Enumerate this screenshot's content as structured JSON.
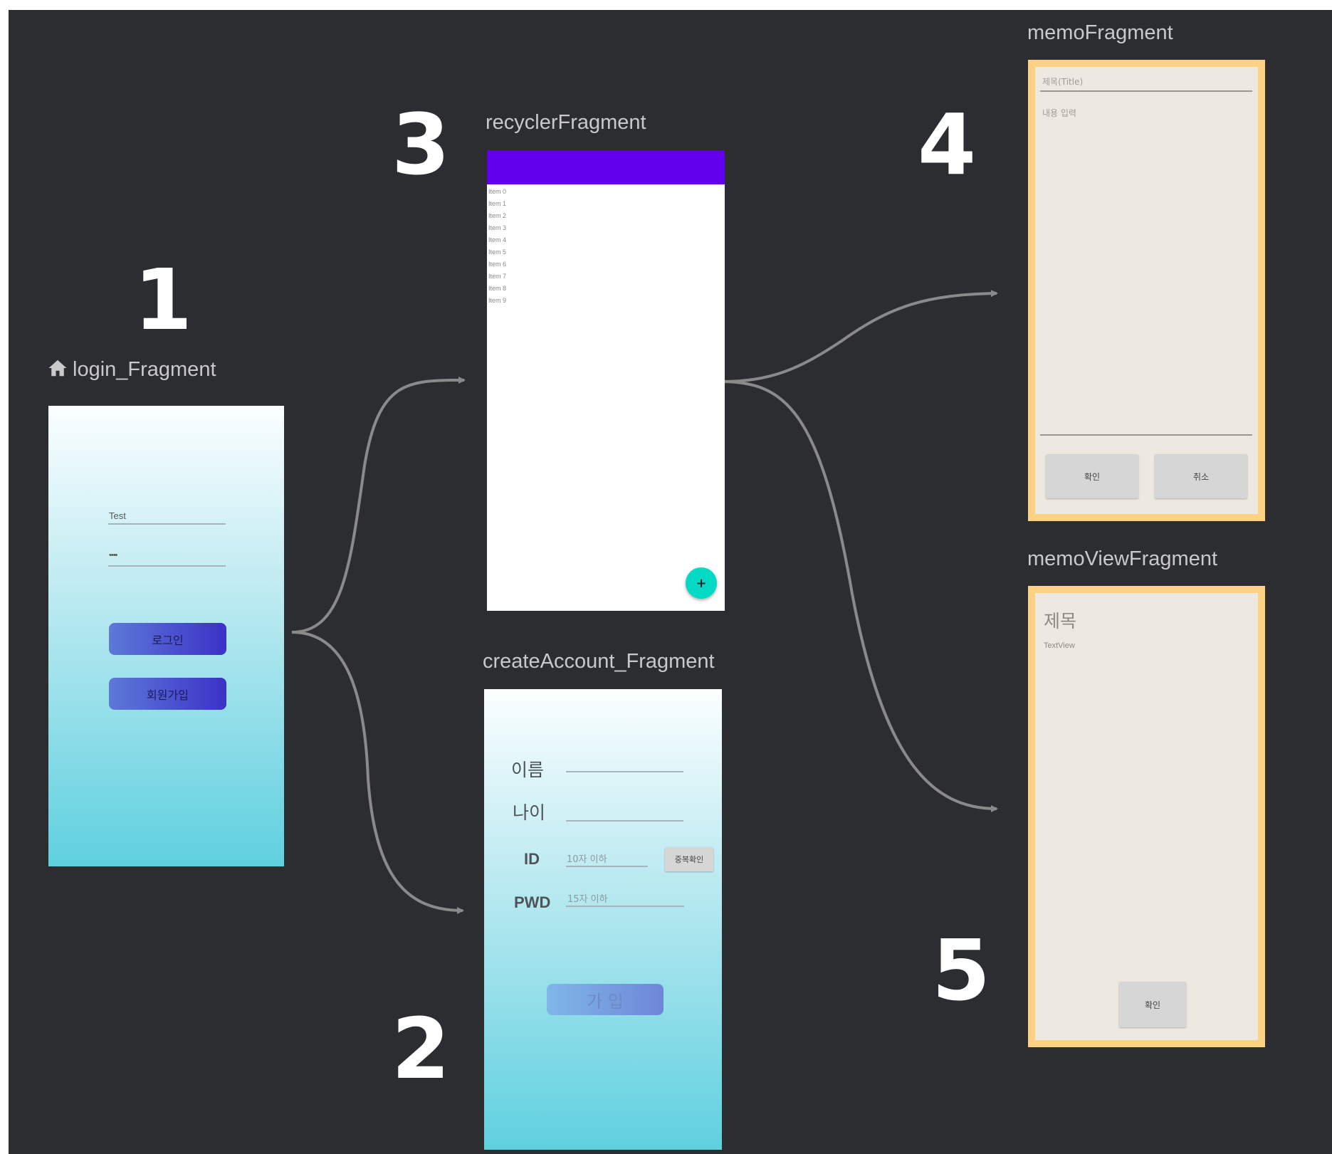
{
  "fragments": {
    "login": {
      "title": "login_Fragment",
      "username_value": "Test",
      "password_value": "••••",
      "login_button": "로그인",
      "signup_button": "회원가입"
    },
    "create_account": {
      "title": "createAccount_Fragment",
      "name_label": "이름",
      "age_label": "나이",
      "id_label": "ID",
      "id_hint": "10자 이하",
      "duplicate_check_button": "중복확인",
      "pwd_label": "PWD",
      "pwd_hint": "15자 이하",
      "join_button": "가 입"
    },
    "recycler": {
      "title": "recyclerFragment",
      "items": [
        "Item 0",
        "Item 1",
        "Item 2",
        "Item 3",
        "Item 4",
        "Item 5",
        "Item 6",
        "Item 7",
        "Item 8",
        "Item 9"
      ],
      "fab_label": "+"
    },
    "memo": {
      "title": "memoFragment",
      "title_hint": "제목(Title)",
      "content_hint": "내용 입력",
      "confirm_button": "확인",
      "cancel_button": "취소"
    },
    "memo_view": {
      "title": "memoViewFragment",
      "heading": "제목",
      "text_view": "TextView",
      "confirm_button": "확인"
    }
  },
  "step_numbers": {
    "login": "1",
    "create_account": "2",
    "recycler": "3",
    "memo": "4",
    "memo_view": "5"
  },
  "colors": {
    "canvas_bg": "#2c2d30",
    "toolbar": "#6200ee",
    "fab": "#03dac5",
    "memo_border": "#fcd184",
    "memo_bg": "#ede9e0",
    "arrow": "#8a8a8a"
  }
}
